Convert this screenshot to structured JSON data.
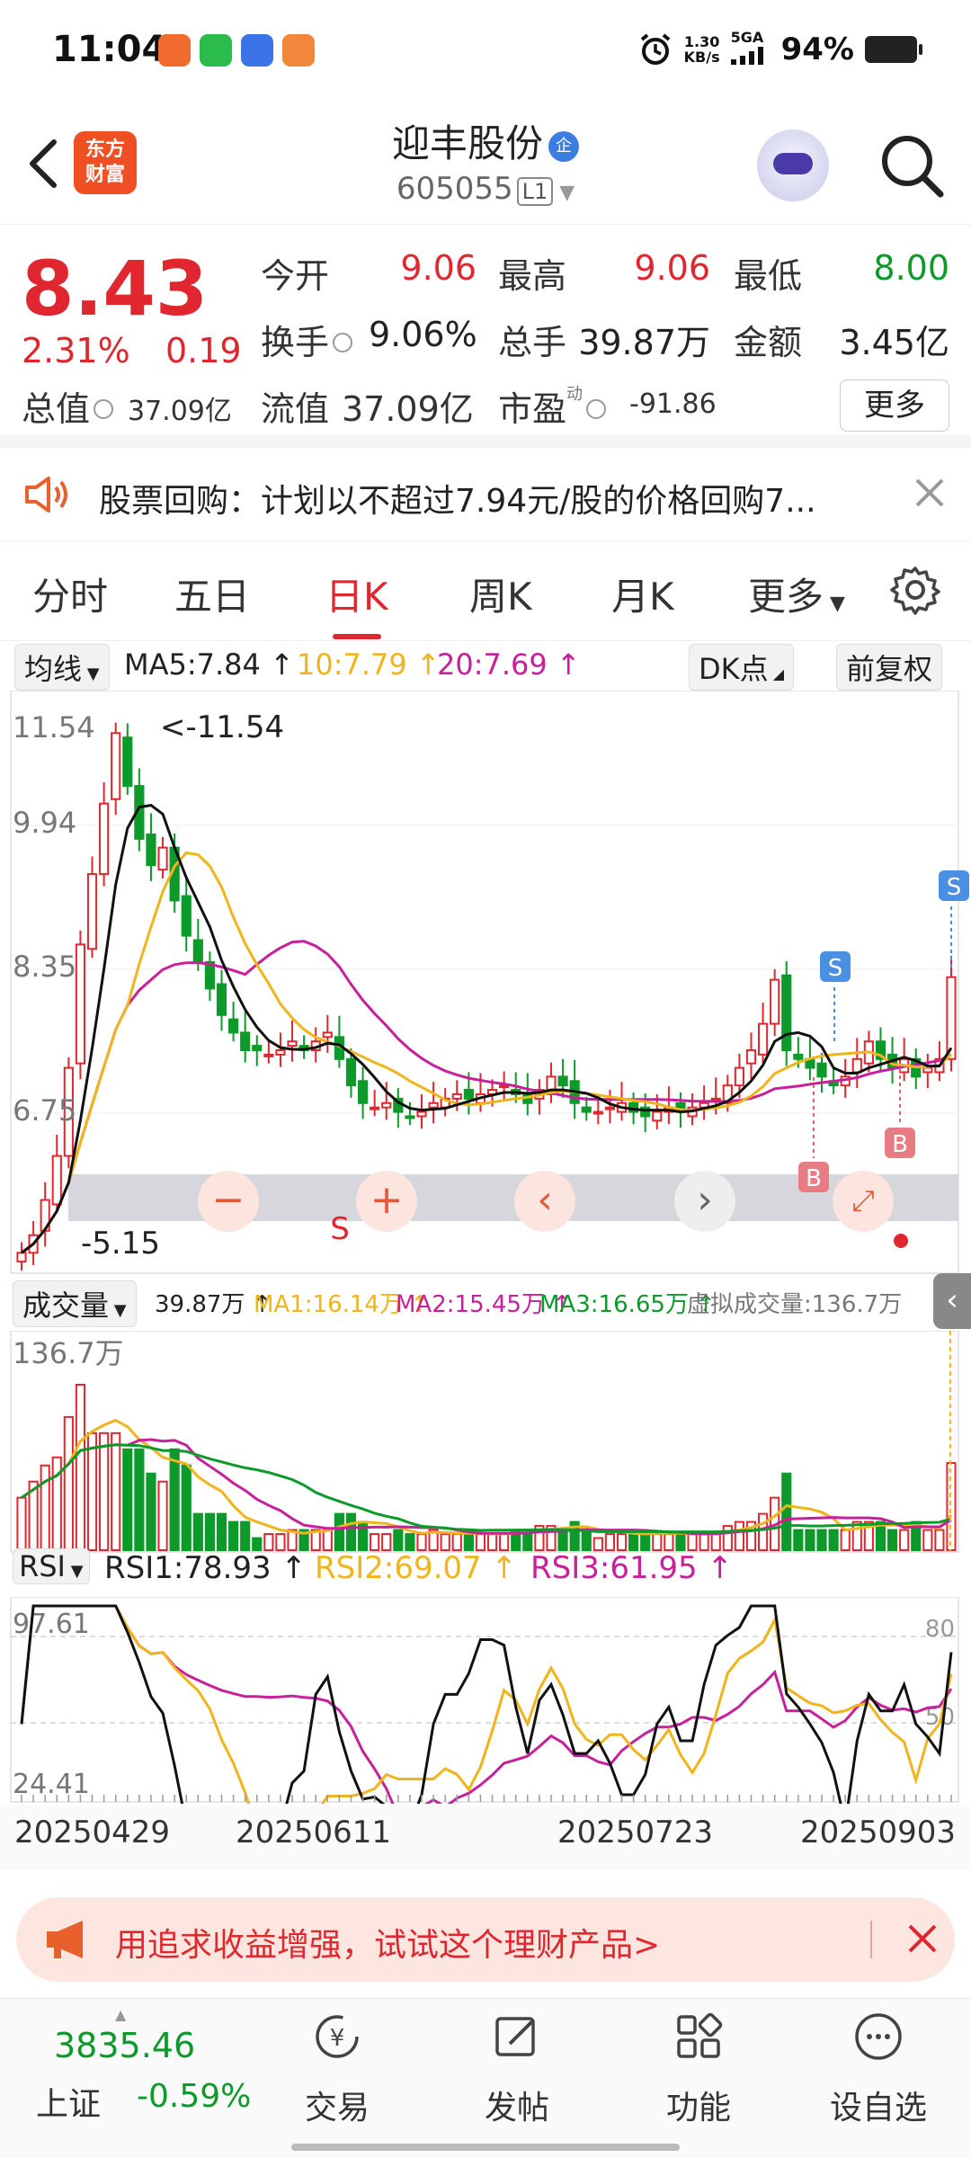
{
  "status_bar": {
    "time": "11:04",
    "net_speed_value": "1.30",
    "net_speed_unit": "KB/s",
    "network": "5GA",
    "battery": "94%"
  },
  "header": {
    "logo_text": "东方财富",
    "stock_name": "迎丰股份",
    "badge": "企",
    "stock_code": "605055",
    "level": "L1"
  },
  "quote": {
    "price": "8.43",
    "change_pct": "2.31%",
    "change_amt": "0.19",
    "open_label": "今开",
    "open": "9.06",
    "high_label": "最高",
    "high": "9.06",
    "low_label": "最低",
    "low": "8.00",
    "turnover_label": "换手",
    "turnover": "9.06%",
    "volume_label": "总手",
    "volume": "39.87万",
    "amount_label": "金额",
    "amount": "3.45亿",
    "mktcap_label": "总值",
    "mktcap": "37.09亿",
    "float_label": "流值",
    "float_cap": "37.09亿",
    "pe_label": "市盈",
    "pe_sup": "动",
    "pe": "-91.86",
    "more_label": "更多"
  },
  "notice": {
    "text": "股票回购：计划以不超过7.94元/股的价格回购7..."
  },
  "tabs": [
    "分时",
    "五日",
    "日K",
    "周K",
    "月K",
    "更多"
  ],
  "active_tab": "日K",
  "kline_panel": {
    "ma_select": "均线",
    "ma5": "MA5:7.84 ↑",
    "ma10": "10:7.79 ↑",
    "ma20": "20:7.69 ↑",
    "dk_button": "DK点",
    "fq_button": "前复权",
    "y_ticks": [
      "11.54",
      "9.94",
      "8.35",
      "6.75"
    ],
    "max_marker": "<-11.54",
    "min_marker": "-5.15",
    "signals": {
      "sell": "S",
      "buy": "B"
    }
  },
  "volume_panel": {
    "select": "成交量",
    "vol": "39.87万 ↑",
    "ma1": "MA1:16.14万 ↑",
    "ma2": "MA2:15.45万 ↑",
    "ma3": "MA3:16.65万 ↑",
    "virtual": "虚拟成交量:136.7万",
    "max_label": "136.7万"
  },
  "rsi_panel": {
    "select": "RSI",
    "rsi1": "RSI1:78.93 ↑",
    "rsi2": "RSI2:69.07 ↑",
    "rsi3": "RSI3:61.95 ↑",
    "y_top": "97.61",
    "y_bottom": "24.41",
    "level_80": "80",
    "level_50": "50"
  },
  "x_dates": [
    "20250429",
    "20250611",
    "20250723",
    "20250903"
  ],
  "colors": {
    "up": "#e0262e",
    "down": "#0c9a2a",
    "ma5": "#111111",
    "ma10": "#f0b41c",
    "ma20": "#c8209a",
    "accent": "#e0262e"
  },
  "promo": {
    "text": "用追求收益增强，试试这个理财产品>"
  },
  "bottom_nav": {
    "index_value": "3835.46",
    "index_name": "上证",
    "index_change": "-0.59%",
    "items": [
      "交易",
      "发帖",
      "功能",
      "设自选"
    ]
  },
  "chart_data": {
    "type": "candlestick",
    "approx_daily_close": [
      5.3,
      5.5,
      5.9,
      6.4,
      7.4,
      8.8,
      9.6,
      10.4,
      11.2,
      10.6,
      10.0,
      9.7,
      9.9,
      9.3,
      8.9,
      8.6,
      8.3,
      8.0,
      7.8,
      7.6,
      7.6,
      7.55,
      7.6,
      7.7,
      7.6,
      7.7,
      7.8,
      7.5,
      7.2,
      7.0,
      6.95,
      7.0,
      6.9,
      6.85,
      6.9,
      7.0,
      7.05,
      7.1,
      7.05,
      7.1,
      7.15,
      7.2,
      7.1,
      7.0,
      7.15,
      7.3,
      7.2,
      7.0,
      6.9,
      6.9,
      6.95,
      7.0,
      6.9,
      6.85,
      6.9,
      6.95,
      6.9,
      6.95,
      7.0,
      7.05,
      7.2,
      7.4,
      7.6,
      7.9,
      8.4,
      7.6,
      7.5,
      7.4,
      7.3,
      7.2,
      7.3,
      7.5,
      7.7,
      7.5,
      7.4,
      7.5,
      7.3,
      7.4,
      7.5,
      8.43
    ],
    "ma5": 7.84,
    "ma10": 7.79,
    "ma20": 7.69,
    "y_range": [
      5.15,
      11.54
    ]
  }
}
